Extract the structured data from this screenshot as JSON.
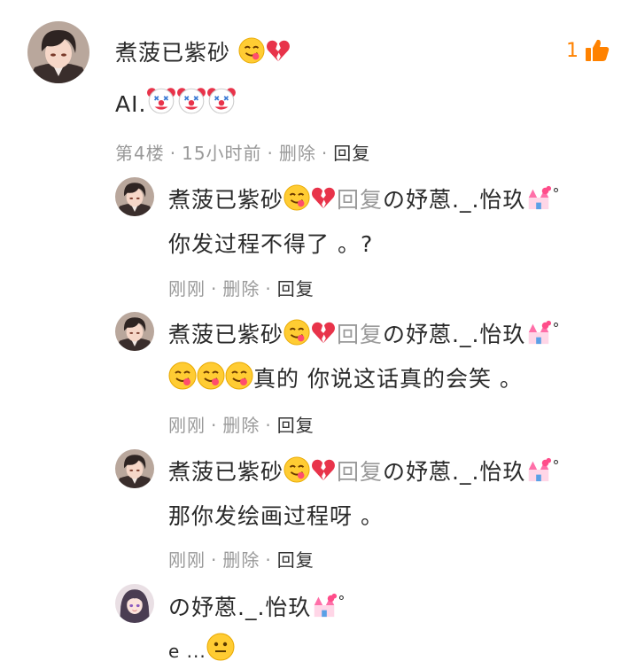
{
  "main_comment": {
    "user": "煮菠已紫砂",
    "text": "AI.",
    "like_count": "1",
    "meta": {
      "floor": "第4楼",
      "time": "15小时前",
      "delete": "删除",
      "reply": "回复"
    }
  },
  "replies": [
    {
      "user": "煮菠已紫砂",
      "reply_word": "回复",
      "target": "の妤蒽._.怡玖",
      "text": "你发过程不得了 。?",
      "meta": {
        "time": "刚刚",
        "delete": "删除",
        "reply": "回复"
      }
    },
    {
      "user": "煮菠已紫砂",
      "reply_word": "回复",
      "target": "の妤蒽._.怡玖",
      "text": "真的 你说这话真的会笑 。",
      "meta": {
        "time": "刚刚",
        "delete": "删除",
        "reply": "回复"
      }
    },
    {
      "user": "煮菠已紫砂",
      "reply_word": "回复",
      "target": "の妤蒽._.怡玖",
      "text": "那你发绘画过程呀 。",
      "meta": {
        "time": "刚刚",
        "delete": "删除",
        "reply": "回复"
      }
    },
    {
      "user": "の妤蒽._.怡玖",
      "text": "e ..."
    }
  ],
  "colors": {
    "like": "#ff8200",
    "meta": "#999999",
    "text": "#2a2a2a"
  }
}
